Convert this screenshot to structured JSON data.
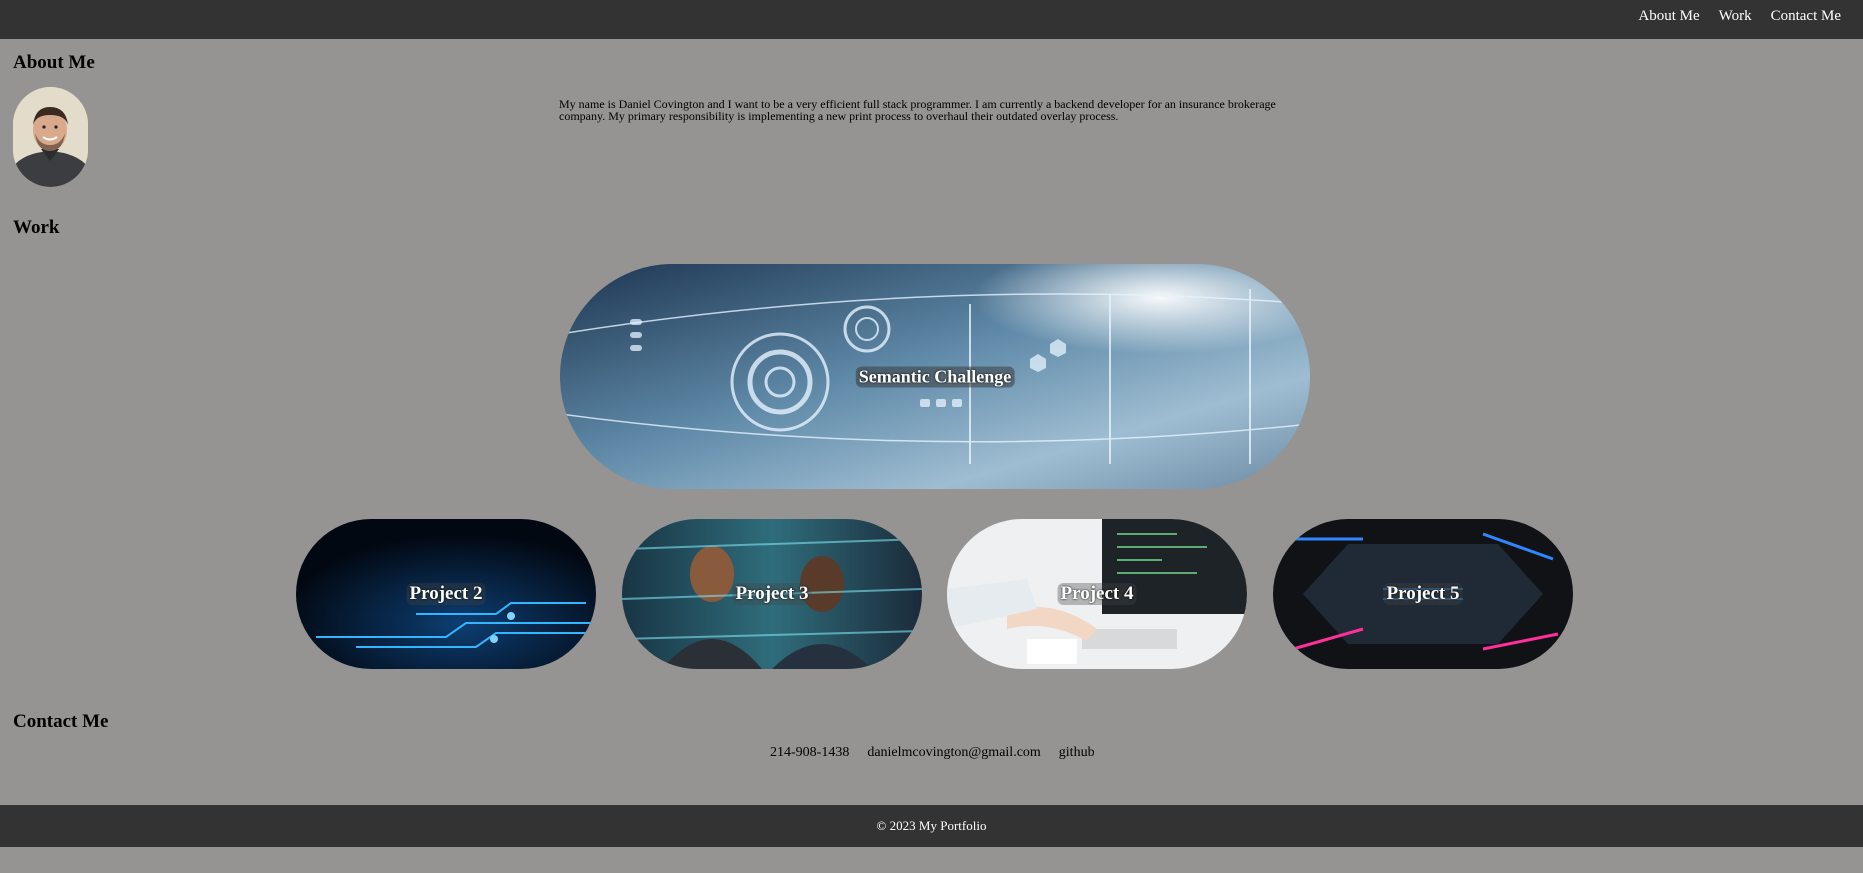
{
  "header": {
    "nav": [
      {
        "label": "About Me"
      },
      {
        "label": "Work"
      },
      {
        "label": "Contact Me"
      }
    ]
  },
  "about": {
    "heading": "About Me",
    "bio": "My name is Daniel Covington and I want to be a very efficient full stack programmer. I am currently a backend developer for an insurance brokerage company. My primary responsibility is implementing a new print process to overhaul their outdated overlay process."
  },
  "work": {
    "heading": "Work",
    "featured": {
      "label": "Semantic Challenge"
    },
    "projects": [
      {
        "label": "Project 2"
      },
      {
        "label": "Project 3"
      },
      {
        "label": "Project 4"
      },
      {
        "label": "Project 5"
      }
    ]
  },
  "contact": {
    "heading": "Contact Me",
    "phone": "214-908-1438",
    "email": "danielmcovington@gmail.com",
    "github": "github"
  },
  "footer": {
    "text": "© 2023 My Portfolio"
  }
}
